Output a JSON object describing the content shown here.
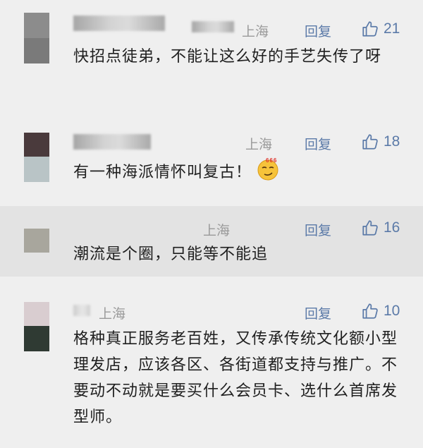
{
  "comments": [
    {
      "location": "上海",
      "reply_label": "回复",
      "likes": "21",
      "text": "快招点徒弟，不能让这么好的手艺失传了呀",
      "avatar_colors": [
        "#8c8c8c",
        "#7a7a7a"
      ]
    },
    {
      "location": "上海",
      "reply_label": "回复",
      "likes": "18",
      "text": "有一种海派情怀叫复古！",
      "emoji": "smirk-666-emoji",
      "avatar_colors": [
        "#4a3a3c",
        "#b9c4c6"
      ]
    },
    {
      "location": "上海",
      "reply_label": "回复",
      "likes": "16",
      "text": "潮流是个圈，只能等不能追",
      "avatar_colors": [
        "#a8a69d"
      ]
    },
    {
      "location": "上海",
      "reply_label": "回复",
      "likes": "10",
      "text": "格种真正服务老百姓，又传承传统文化额小型理发店，应该各区、各街道都支持与推广。不要动不动就是要买什么会员卡、选什么首席发型师。",
      "avatar_colors": [
        "#d9cdd0",
        "#2f3a33"
      ]
    }
  ],
  "colors": {
    "accent": "#5b7aa8",
    "muted": "#9a9a9a",
    "text": "#1f1f1f",
    "background": "#efefef",
    "highlight_row": "#e3e3e3"
  },
  "icons": {
    "like": "thumb-up-outline-icon"
  }
}
